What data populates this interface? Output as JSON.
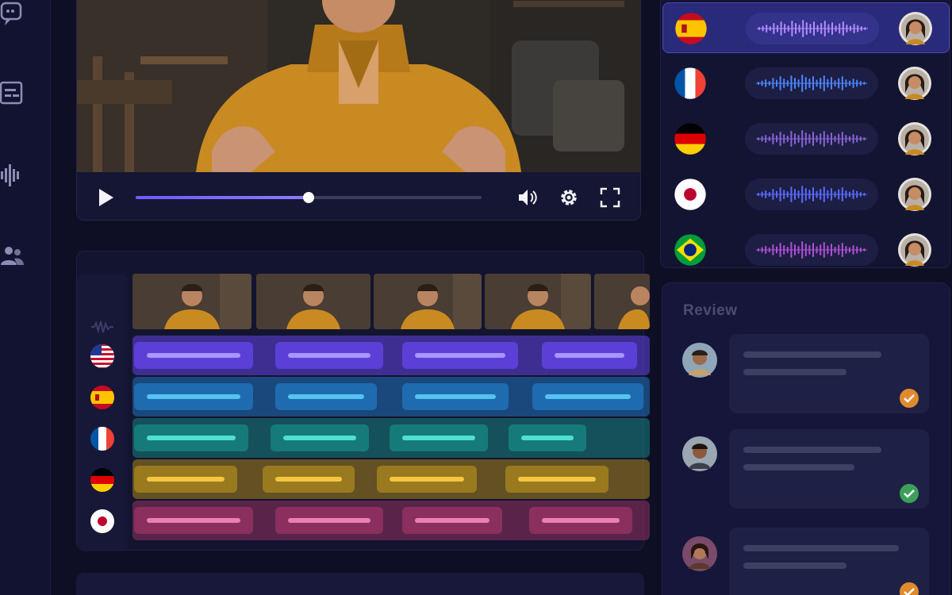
{
  "sidebar": {
    "items": [
      {
        "icon": "chat-icon"
      },
      {
        "icon": "subtitles-icon"
      },
      {
        "icon": "waveform-icon"
      },
      {
        "icon": "users-icon"
      }
    ]
  },
  "player": {
    "progress": 0.5,
    "controls": [
      "play-icon",
      "volume-icon",
      "gear-icon",
      "fullscreen-icon"
    ]
  },
  "timeline": {
    "tracks": [
      {
        "language": "en",
        "flag": "flag-usa-icon",
        "color": "#5b3fd6",
        "bar": "#a896ff"
      },
      {
        "language": "es",
        "flag": "flag-spain-icon",
        "color": "#1f6bb0",
        "bar": "#55c2f0"
      },
      {
        "language": "fr",
        "flag": "flag-france-icon",
        "color": "#177a7a",
        "bar": "#4fe0cf"
      },
      {
        "language": "de",
        "flag": "flag-germany-icon",
        "color": "#9a7a1e",
        "bar": "#f5c542"
      },
      {
        "language": "ja",
        "flag": "flag-japan-icon",
        "color": "#8a2f5e",
        "bar": "#ea7fb2"
      }
    ]
  },
  "languages": [
    {
      "flag": "flag-spain-icon",
      "active": true,
      "wave": "#b58bff"
    },
    {
      "flag": "flag-france-icon",
      "active": false,
      "wave": "#4c86ff"
    },
    {
      "flag": "flag-germany-icon",
      "active": false,
      "wave": "#8a63d6"
    },
    {
      "flag": "flag-japan-icon",
      "active": false,
      "wave": "#5a6bff"
    },
    {
      "flag": "flag-brazil-icon",
      "active": false,
      "wave": "#b04fd6"
    }
  ],
  "review": {
    "title": "Review",
    "comments": [
      {
        "status": "approved",
        "check_color": "#e08a2e"
      },
      {
        "status": "approved",
        "check_color": "#3aa05a"
      },
      {
        "status": "approved",
        "check_color": "#e08a2e"
      }
    ]
  },
  "colors": {
    "accent": "#6a5cff",
    "background": "#0e0f24"
  }
}
